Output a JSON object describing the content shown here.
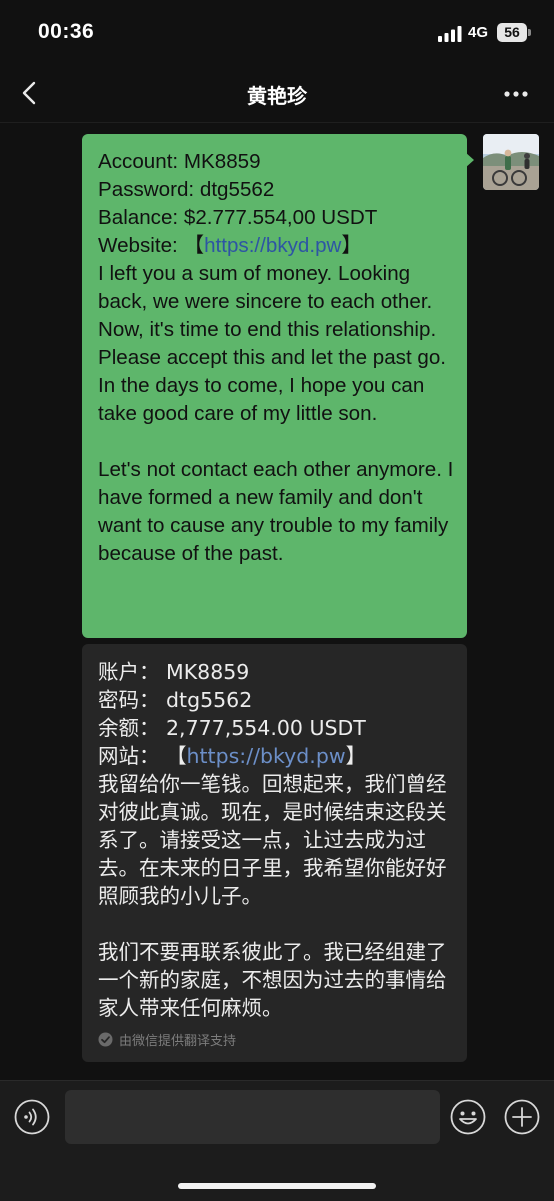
{
  "status_bar": {
    "time": "00:36",
    "network": "4G",
    "battery": "56"
  },
  "chat": {
    "contact_name": "黄艳珍"
  },
  "message_en": {
    "line1": "Account: MK8859",
    "line2": "Password: dtg5562",
    "line3": "Balance: $2.777.554,00 USDT",
    "website_label": "Website: 【",
    "website_url": "https://bkyd.pw",
    "website_close": "】",
    "body": "I left you a sum of money. Looking back, we were sincere to each other. Now, it's time to end this relationship. Please accept this and let the past go. In the days to come, I hope you can take good care of my little son.\n\nLet's not contact each other anymore. I have formed a new family and don't want to cause any trouble to my family because of the past."
  },
  "message_zh": {
    "line1": "账户：  MK8859",
    "line2": "密码：  dtg5562",
    "line3": "余额：  2,777,554.00 USDT",
    "website_label": "网站：  【",
    "website_url": "https://bkyd.pw",
    "website_close": "】",
    "body": "我留给你一笔钱。回想起来，我们曾经对彼此真诚。现在，是时候结束这段关系了。请接受这一点，让过去成为过去。在未来的日子里，我希望你能好好照顾我的小儿子。\n\n我们不要再联系彼此了。我已经组建了一个新的家庭，不想因为过去的事情给家人带来任何麻烦。",
    "translation_note": "由微信提供翻译支持"
  },
  "input": {
    "value": ""
  },
  "colors": {
    "background": "#111111",
    "bubble_outgoing": "#5eb66b",
    "translation_box": "#262626",
    "link": "#2d55a4"
  }
}
